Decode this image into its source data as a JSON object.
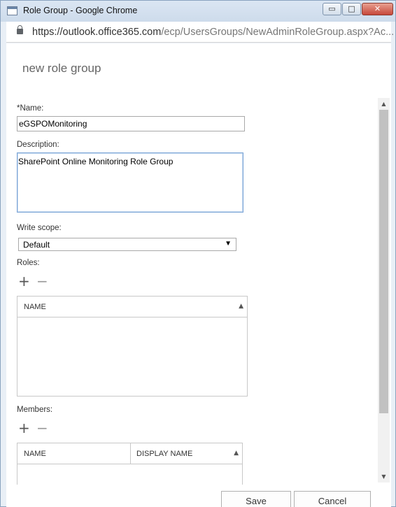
{
  "window": {
    "title": "Role Group - Google Chrome",
    "controls": {
      "minimize": "▭",
      "maximize": "□",
      "close": "✕"
    }
  },
  "address_bar": {
    "url_host": "https://outlook.office365.com",
    "url_path": "/ecp/UsersGroups/NewAdminRoleGroup.aspx?Ac..."
  },
  "page": {
    "title": "new role group",
    "name_label": "*Name:",
    "name_value": "eGSPOMonitoring",
    "description_label": "Description:",
    "description_value": "SharePoint Online Monitoring Role Group",
    "write_scope_label": "Write scope:",
    "write_scope_value": "Default",
    "roles_label": "Roles:",
    "roles_grid": {
      "columns": [
        "NAME"
      ]
    },
    "members_label": "Members:",
    "members_grid": {
      "columns": [
        "NAME",
        "DISPLAY NAME"
      ]
    },
    "add_symbol": "+",
    "remove_symbol": "−",
    "sort_symbol": "▲",
    "dropdown_symbol": "▼"
  },
  "footer": {
    "save_label": "Save",
    "cancel_label": "Cancel"
  },
  "icons": {
    "app": "window-icon",
    "lock": "lock-icon",
    "add": "plus-icon",
    "remove": "minus-icon",
    "sort": "sort-ascending-icon"
  },
  "colors": {
    "titlebar": "#cddbeb",
    "focus_border": "#7aa4d6",
    "close_button": "#c7483a"
  }
}
